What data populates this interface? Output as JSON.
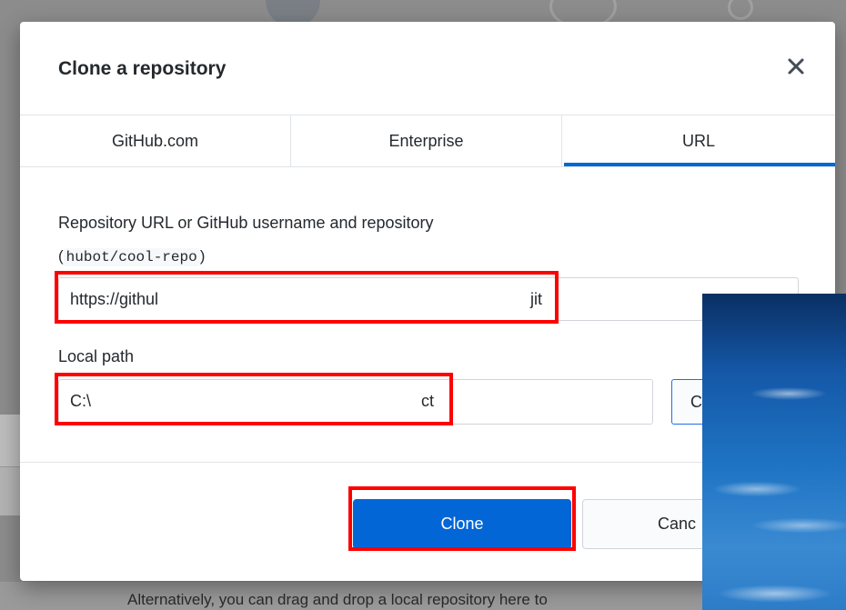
{
  "dialog": {
    "title": "Clone a repository",
    "close_icon": "close-icon"
  },
  "tabs": [
    {
      "label": "GitHub.com",
      "active": false
    },
    {
      "label": "Enterprise",
      "active": false
    },
    {
      "label": "URL",
      "active": true
    }
  ],
  "url_field": {
    "label": "Repository URL or GitHub username and repository",
    "hint_open": "(",
    "hint_code": "hubot/cool-repo",
    "hint_close": ")",
    "value_start": "https://githul",
    "value_end": "jit"
  },
  "path_field": {
    "label": "Local path",
    "value_start": "C:\\",
    "value_end": "ct",
    "choose_label": "C"
  },
  "buttons": {
    "clone": "Clone",
    "cancel": "Canc"
  },
  "background": {
    "bottom_text": "Alternatively, you can drag and drop a local repository here to"
  },
  "colors": {
    "accent": "#0366d6",
    "annotation": "#ff0000"
  }
}
